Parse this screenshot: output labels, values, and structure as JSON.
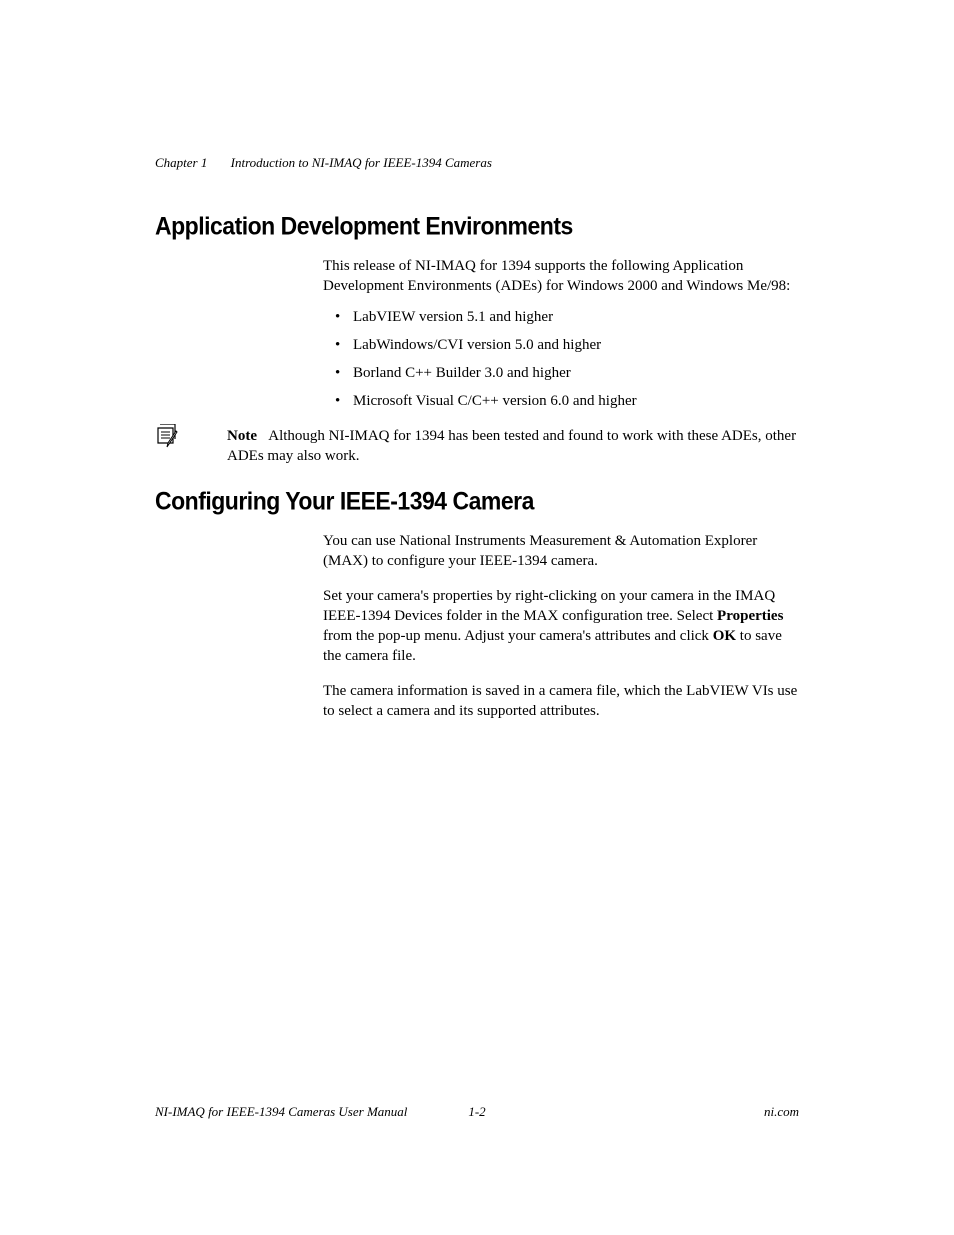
{
  "header": {
    "chapter": "Chapter 1",
    "title": "Introduction to NI-IMAQ for IEEE-1394 Cameras"
  },
  "section1": {
    "heading": "Application Development Environments",
    "intro": "This release of NI-IMAQ for 1394 supports the following Application Development Environments (ADEs) for Windows 2000 and Windows Me/98:",
    "bullets": [
      "LabVIEW version 5.1 and higher",
      "LabWindows/CVI version 5.0 and higher",
      "Borland C++ Builder 3.0 and higher",
      "Microsoft Visual C/C++ version 6.0 and higher"
    ],
    "note_label": "Note",
    "note_text": "Although NI-IMAQ for 1394 has been tested and found to work with these ADEs, other ADEs may also work."
  },
  "section2": {
    "heading": "Configuring Your IEEE-1394 Camera",
    "para1": "You can use National Instruments Measurement & Automation Explorer (MAX) to configure your IEEE-1394 camera.",
    "para2_pre": "Set your camera's properties by right-clicking on your camera in the IMAQ IEEE-1394 Devices folder in the MAX configuration tree. Select ",
    "para2_bold1": "Properties",
    "para2_mid": " from the pop-up menu. Adjust your camera's attributes and click ",
    "para2_bold2": "OK",
    "para2_post": " to save the camera file.",
    "para3": "The camera information is saved in a camera file, which the LabVIEW VIs use to select a camera and its supported attributes."
  },
  "footer": {
    "left": "NI-IMAQ for IEEE-1394 Cameras User Manual",
    "center": "1-2",
    "right": "ni.com"
  }
}
